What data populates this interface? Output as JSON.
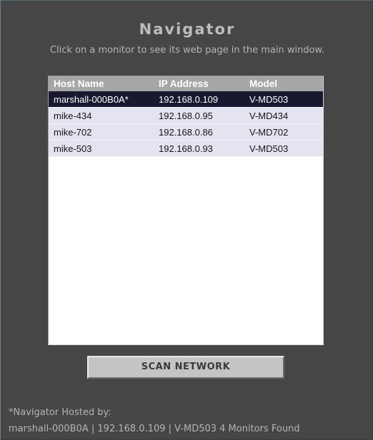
{
  "header": {
    "title": "Navigator",
    "subtitle": "Click on a monitor to see its web page in the main window."
  },
  "table": {
    "columns": [
      "Host Name",
      "IP Address",
      "Model"
    ],
    "rows": [
      {
        "host": "marshall-000B0A*",
        "ip": "192.168.0.109",
        "model": "V-MD503",
        "selected": true
      },
      {
        "host": "mike-434",
        "ip": "192.168.0.95",
        "model": "V-MD434",
        "selected": false
      },
      {
        "host": "mike-702",
        "ip": "192.168.0.86",
        "model": "V-MD702",
        "selected": false
      },
      {
        "host": "mike-503",
        "ip": "192.168.0.93",
        "model": "V-MD503",
        "selected": false
      }
    ]
  },
  "actions": {
    "scan_label": "SCAN NETWORK"
  },
  "footer": {
    "hosted_by_label": "*Navigator Hosted by:",
    "status": "marshall-000B0A | 192.168.0.109 | V-MD503  4 Monitors Found"
  },
  "colors": {
    "background": "#464646",
    "selected_row": "#181830",
    "row": "#e4e4f0",
    "header_row": "#a6a6a6"
  }
}
